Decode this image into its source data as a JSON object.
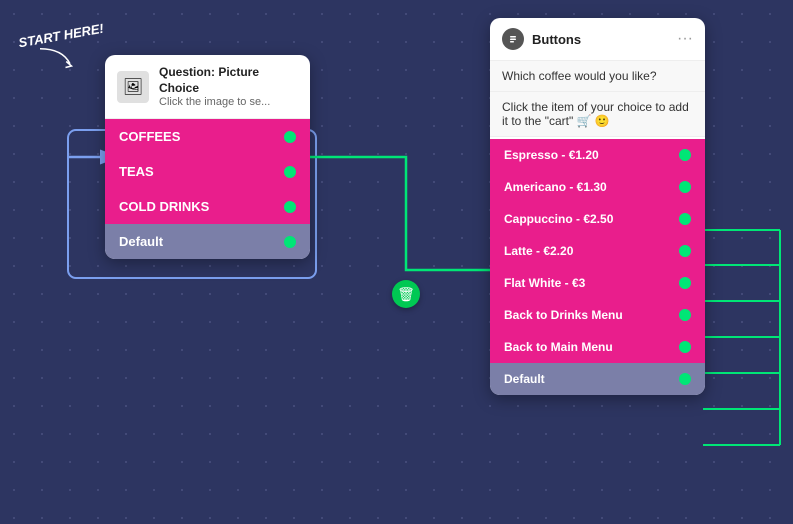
{
  "start_label": "START HERE!",
  "question_card": {
    "icon": "🖼",
    "title": "Question: Picture Choice",
    "subtitle": "Click the image to se...",
    "buttons": [
      {
        "label": "COFFEES",
        "type": "pink"
      },
      {
        "label": "TEAS",
        "type": "pink"
      },
      {
        "label": "COLD DRINKS",
        "type": "pink"
      },
      {
        "label": "Default",
        "type": "default"
      }
    ]
  },
  "buttons_card": {
    "title": "Buttons",
    "message1": "Which coffee would you like?",
    "message2": "Click the item of your choice to add it to the \"cart\" 🛒 🙂",
    "buttons": [
      {
        "label": "Espresso - €1.20",
        "type": "pink"
      },
      {
        "label": "Americano - €1.30",
        "type": "pink"
      },
      {
        "label": "Cappuccino - €2.50",
        "type": "pink"
      },
      {
        "label": "Latte - €2.20",
        "type": "pink"
      },
      {
        "label": "Flat White - €3",
        "type": "pink"
      },
      {
        "label": "Back to Drinks Menu",
        "type": "pink"
      },
      {
        "label": "Back to Main Menu",
        "type": "pink"
      },
      {
        "label": "Default",
        "type": "default"
      }
    ]
  }
}
